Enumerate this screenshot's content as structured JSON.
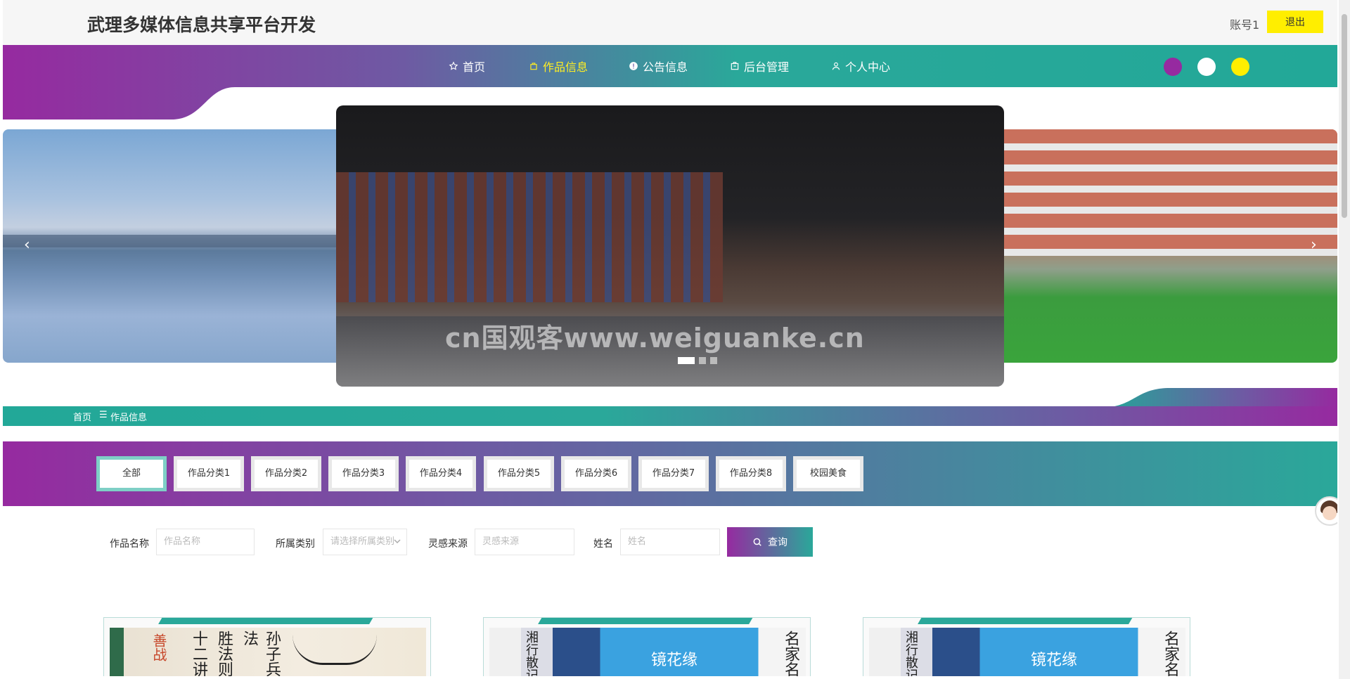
{
  "header": {
    "site_title": "武理多媒体信息共享平台开发",
    "account_label": "账号1",
    "logout_label": "退出"
  },
  "nav": {
    "items": [
      {
        "label": "首页",
        "icon": "star-icon",
        "active": false
      },
      {
        "label": "作品信息",
        "icon": "bag-icon",
        "active": true
      },
      {
        "label": "公告信息",
        "icon": "info-icon",
        "active": false
      },
      {
        "label": "后台管理",
        "icon": "box-icon",
        "active": false
      },
      {
        "label": "个人中心",
        "icon": "user-icon",
        "active": false
      }
    ],
    "theme_colors": [
      "#962aa0",
      "#ffffff",
      "#ffee00"
    ]
  },
  "carousel": {
    "watermark": "cn国观客www.weiguanke.cn",
    "active_index": 0,
    "slide_count": 3
  },
  "breadcrumb": {
    "home": "首页",
    "separator": "☰",
    "current": "作品信息"
  },
  "categories": [
    "全部",
    "作品分类1",
    "作品分类2",
    "作品分类3",
    "作品分类4",
    "作品分类5",
    "作品分类6",
    "作品分类7",
    "作品分类8",
    "校园美食"
  ],
  "search": {
    "fields": [
      {
        "label": "作品名称",
        "placeholder": "作品名称"
      },
      {
        "label": "所属类别",
        "placeholder": "请选择所属类别"
      },
      {
        "label": "灵感来源",
        "placeholder": "灵感来源"
      },
      {
        "label": "姓名",
        "placeholder": "姓名"
      }
    ],
    "query_label": "查询"
  },
  "cards": [
    {
      "cover_texts": [
        "善战",
        "十二讲",
        "胜法则",
        "孙子兵法"
      ]
    },
    {
      "cover_texts": [
        "镜花缘",
        "名家名",
        "湘行散记"
      ]
    },
    {
      "cover_texts": [
        "镜花缘",
        "名家名",
        "湘行散记"
      ]
    }
  ],
  "colors": {
    "purple": "#962aa0",
    "teal": "#22a898",
    "yellow": "#ffee00"
  }
}
